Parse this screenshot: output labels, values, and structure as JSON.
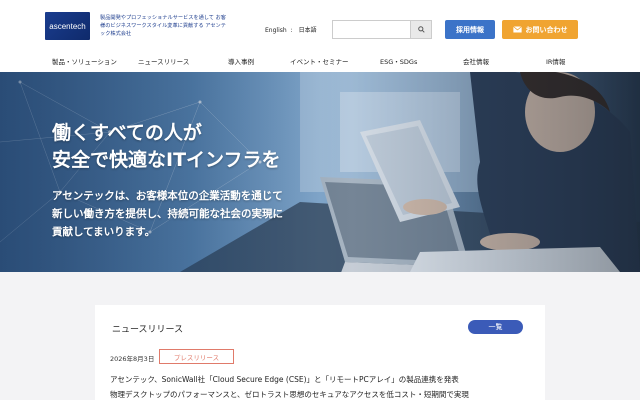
{
  "header": {
    "logo_text": "ascentech",
    "tagline": "製品開発やプロフェッショナルサービスを通して お客様のビジネスワークスタイル変革に貢献する アセンテック株式会社",
    "lang_en": "English",
    "lang_sep": ":",
    "lang_ja": "日本語",
    "search_placeholder": "",
    "recruit_label": "採用情報",
    "contact_label": "お問い合わせ"
  },
  "nav": {
    "items": [
      {
        "label": "製品・ソリューション"
      },
      {
        "label": "ニュースリリース"
      },
      {
        "label": "導入事例"
      },
      {
        "label": "イベント・セミナー"
      },
      {
        "label": "ESG・SDGs"
      },
      {
        "label": "会社情報"
      },
      {
        "label": "IR情報"
      }
    ]
  },
  "hero": {
    "heading_line1": "働くすべての人が",
    "heading_line2": "安全で快適なITインフラを",
    "body_line1": "アセンテックは、お客様本位の企業活動を通じて",
    "body_line2": "新しい働き方を提供し、持続可能な社会の実現に",
    "body_line3": "貢献してまいります。"
  },
  "news": {
    "title": "ニュースリリース",
    "more_label": "一覧",
    "date": "2026年8月3日",
    "tag": "プレスリリース",
    "line1": "アセンテック、SonicWall社「Cloud Secure Edge (CSE)」と「リモートPCアレイ」の製品連携を発表",
    "line2": "物理デスクトップのパフォーマンスと、ゼロトラスト思想のセキュアなアクセスを低コスト・短期間で実現"
  },
  "colors": {
    "brand_blue": "#1a3d8f",
    "recruit": "#3b73c8",
    "contact": "#f0a431",
    "tag_red": "#e07a6a",
    "more_blue": "#3b5bb8"
  }
}
